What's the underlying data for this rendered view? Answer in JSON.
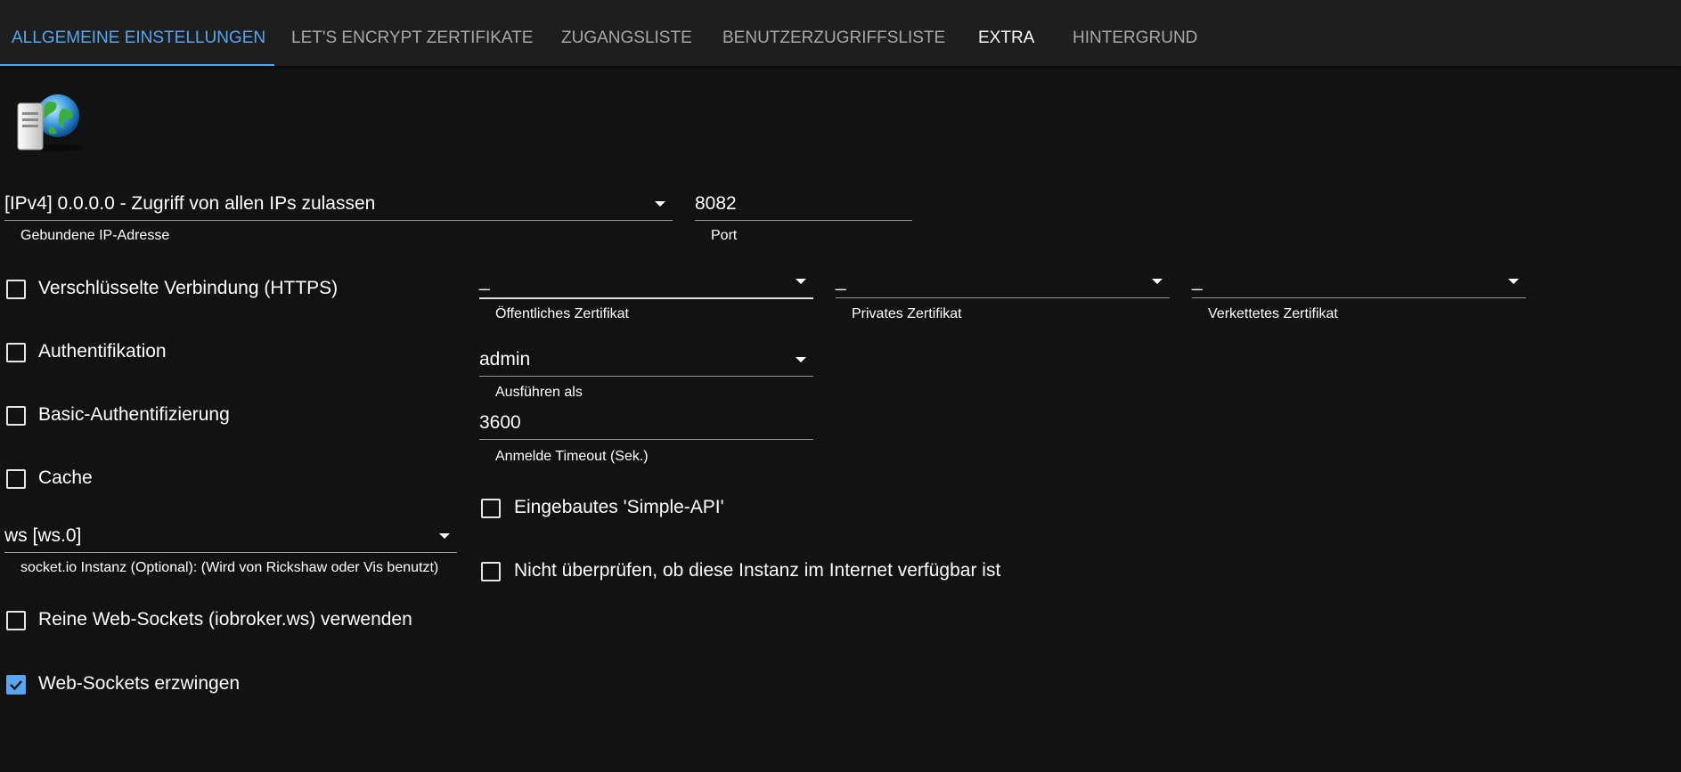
{
  "tabs": [
    {
      "label": "Allgemeine Einstellungen"
    },
    {
      "label": "Let's Encrypt Zertifikate"
    },
    {
      "label": "Zugangsliste"
    },
    {
      "label": "Benutzerzugriffsliste"
    },
    {
      "label": "Extra"
    },
    {
      "label": "Hintergrund"
    }
  ],
  "colors": {
    "accent": "#58a6f0",
    "background": "#121212",
    "tabbar": "#1e1e1e"
  },
  "logo": {
    "icon": "server-globe-icon"
  },
  "bind": {
    "value": "[IPv4] 0.0.0.0 - Zugriff von allen IPs zulassen",
    "label": "Gebundene IP-Adresse"
  },
  "port": {
    "value": "8082",
    "label": "Port"
  },
  "https": {
    "label": "Verschlüsselte Verbindung (HTTPS)",
    "checked": false
  },
  "cert_public": {
    "value": "_",
    "label": "Öffentliches Zertifikat"
  },
  "cert_private": {
    "value": "_",
    "label": "Privates Zertifikat"
  },
  "cert_chained": {
    "value": "_",
    "label": "Verkettetes Zertifikat"
  },
  "auth": {
    "label": "Authentifikation",
    "checked": false
  },
  "run_as": {
    "value": "admin",
    "label": "Ausführen als"
  },
  "basic_auth": {
    "label": "Basic-Authentifizierung",
    "checked": false
  },
  "timeout": {
    "value": "3600",
    "label": "Anmelde Timeout (Sek.)"
  },
  "cache": {
    "label": "Cache",
    "checked": false
  },
  "simple_api": {
    "label": "Eingebautes 'Simple-API'",
    "checked": false
  },
  "socketio": {
    "value": "ws [ws.0]",
    "label": "socket.io Instanz (Optional): (Wird von Rickshaw oder Vis benutzt)"
  },
  "no_check": {
    "label": "Nicht überprüfen, ob diese Instanz im Internet verfügbar ist",
    "checked": false
  },
  "pure_ws": {
    "label": "Reine Web-Sockets (iobroker.ws) verwenden",
    "checked": false
  },
  "force_ws": {
    "label": "Web-Sockets erzwingen",
    "checked": true
  }
}
